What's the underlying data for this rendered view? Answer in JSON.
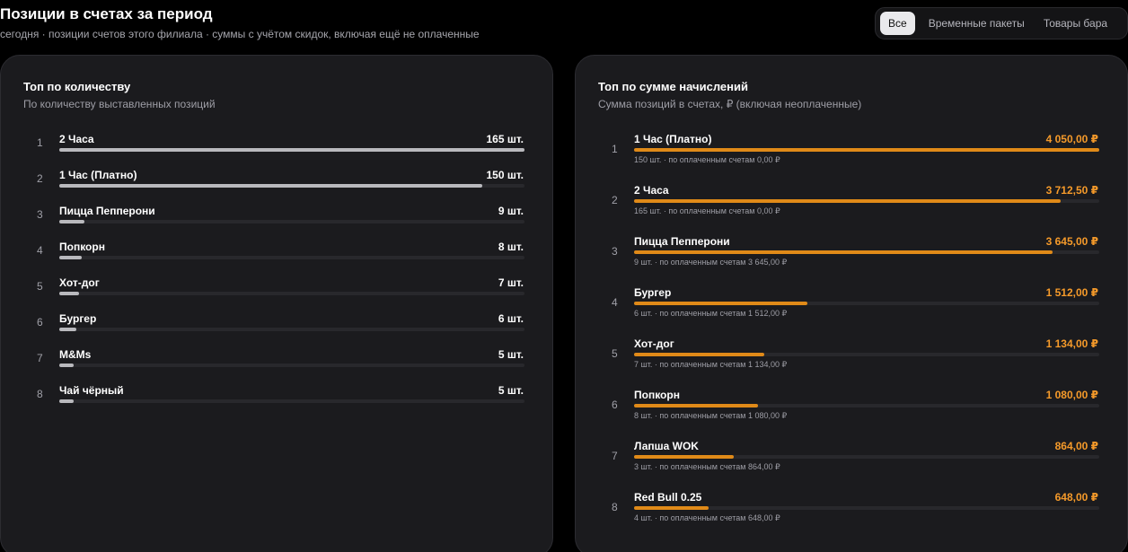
{
  "header": {
    "title": "Позиции в счетах за период",
    "subtitle": "сегодня · позиции счетов этого филиала · суммы с учётом скидок, включая ещё не оплаченные"
  },
  "filters": [
    {
      "label": "Все",
      "active": true
    },
    {
      "label": "Временные пакеты",
      "active": false
    },
    {
      "label": "Товары бара",
      "active": false
    }
  ],
  "colors": {
    "qty_bar": "#b9b9bd",
    "sum_bar": "#e08a18",
    "sum_text": "#f59a2a"
  },
  "chart_data": [
    {
      "type": "bar",
      "title": "Топ по количеству",
      "subtitle": "По количеству выставленных позиций",
      "unit": "шт.",
      "items": [
        {
          "rank": "1",
          "name": "2 Часа",
          "value": 165,
          "label": "165 шт."
        },
        {
          "rank": "2",
          "name": "1 Час (Платно)",
          "value": 150,
          "label": "150 шт."
        },
        {
          "rank": "3",
          "name": "Пицца Пепперони",
          "value": 9,
          "label": "9 шт."
        },
        {
          "rank": "4",
          "name": "Попкорн",
          "value": 8,
          "label": "8 шт."
        },
        {
          "rank": "5",
          "name": "Хот-дог",
          "value": 7,
          "label": "7 шт."
        },
        {
          "rank": "6",
          "name": "Бургер",
          "value": 6,
          "label": "6 шт."
        },
        {
          "rank": "7",
          "name": "M&Ms",
          "value": 5,
          "label": "5 шт."
        },
        {
          "rank": "8",
          "name": "Чай чёрный",
          "value": 5,
          "label": "5 шт."
        }
      ]
    },
    {
      "type": "bar",
      "title": "Топ по сумме начислений",
      "subtitle": "Сумма позиций в счетах, ₽ (включая неоплаченные)",
      "unit": "₽",
      "items": [
        {
          "rank": "1",
          "name": "1 Час (Платно)",
          "value": 4050.0,
          "label": "4 050,00 ₽",
          "meta": "150 шт. · по оплаченным счетам 0,00 ₽"
        },
        {
          "rank": "2",
          "name": "2 Часа",
          "value": 3712.5,
          "label": "3 712,50 ₽",
          "meta": "165 шт. · по оплаченным счетам 0,00 ₽"
        },
        {
          "rank": "3",
          "name": "Пицца Пепперони",
          "value": 3645.0,
          "label": "3 645,00 ₽",
          "meta": "9 шт. · по оплаченным счетам 3 645,00 ₽"
        },
        {
          "rank": "4",
          "name": "Бургер",
          "value": 1512.0,
          "label": "1 512,00 ₽",
          "meta": "6 шт. · по оплаченным счетам 1 512,00 ₽"
        },
        {
          "rank": "5",
          "name": "Хот-дог",
          "value": 1134.0,
          "label": "1 134,00 ₽",
          "meta": "7 шт. · по оплаченным счетам 1 134,00 ₽"
        },
        {
          "rank": "6",
          "name": "Попкорн",
          "value": 1080.0,
          "label": "1 080,00 ₽",
          "meta": "8 шт. · по оплаченным счетам 1 080,00 ₽"
        },
        {
          "rank": "7",
          "name": "Лапша WOK",
          "value": 864.0,
          "label": "864,00 ₽",
          "meta": "3 шт. · по оплаченным счетам 864,00 ₽"
        },
        {
          "rank": "8",
          "name": "Red Bull 0.25",
          "value": 648.0,
          "label": "648,00 ₽",
          "meta": "4 шт. · по оплаченным счетам 648,00 ₽"
        }
      ]
    }
  ]
}
